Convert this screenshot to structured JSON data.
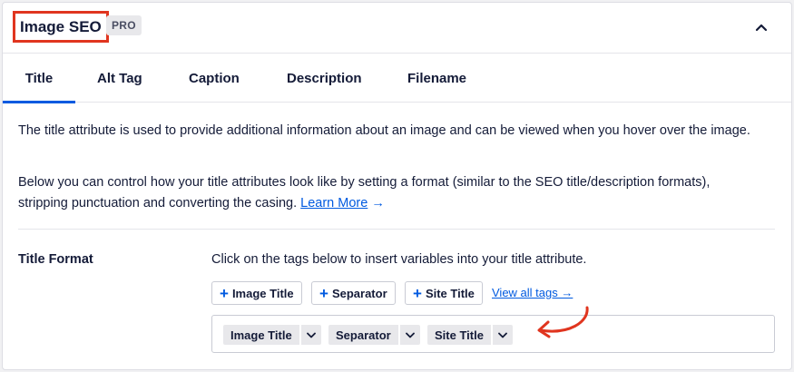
{
  "header": {
    "title": "Image SEO",
    "badge": "PRO"
  },
  "tabs": [
    {
      "label": "Title",
      "active": true
    },
    {
      "label": "Alt Tag",
      "active": false
    },
    {
      "label": "Caption",
      "active": false
    },
    {
      "label": "Description",
      "active": false
    },
    {
      "label": "Filename",
      "active": false
    }
  ],
  "content": {
    "intro": "The title attribute is used to provide additional information about an image and can be viewed when you hover over the image.",
    "control_text": "Below you can control how your title attributes look like by setting a format (similar to the SEO title/description formats), stripping punctuation and converting the casing.",
    "learn_more": "Learn More",
    "learn_more_arrow": "→"
  },
  "title_format": {
    "label": "Title Format",
    "help": "Click on the tags below to insert variables into your title attribute.",
    "insert_tags": [
      {
        "label": "Image Title"
      },
      {
        "label": "Separator"
      },
      {
        "label": "Site Title"
      }
    ],
    "view_all": "View all tags →",
    "selected_tags": [
      {
        "label": "Image Title"
      },
      {
        "label": "Separator"
      },
      {
        "label": "Site Title"
      }
    ]
  },
  "colors": {
    "accent": "#005ae0",
    "highlight_red": "#e0351f",
    "text": "#141b38"
  },
  "icons": {
    "collapse": "chevron-up-icon",
    "add": "plus-icon",
    "chip_toggle": "chevron-down-icon",
    "annotation": "curved-arrow-icon"
  }
}
